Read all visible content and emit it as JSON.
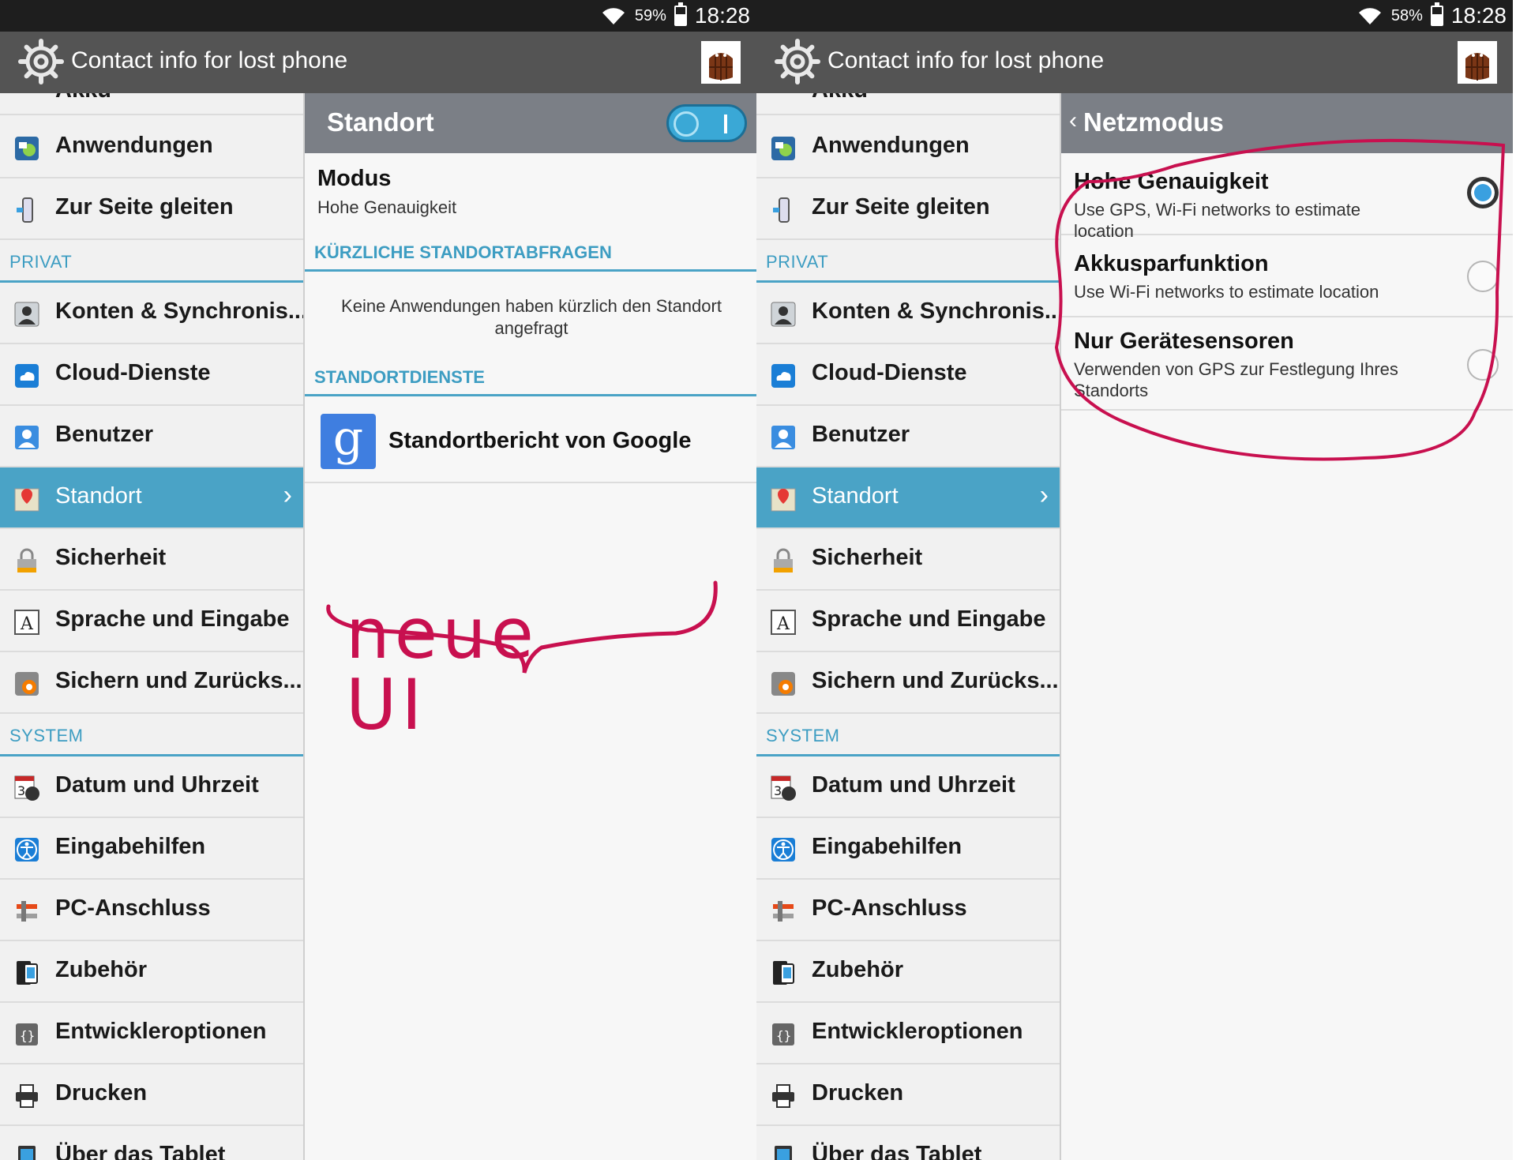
{
  "left": {
    "status": {
      "battery": "59%",
      "time": "18:28",
      "battery_level": 0.59
    },
    "app_title": "Contact info for lost phone",
    "list_items": [
      "Akku",
      "Anwendungen",
      "Zur Seite gleiten",
      "PRIVAT",
      "Konten & Synchronis...",
      "Cloud-Dienste",
      "Benutzer",
      "Standort",
      "Sicherheit",
      "Sprache und Eingabe",
      "Sichern und Zurücks...",
      "SYSTEM",
      "Datum und Uhrzeit",
      "Eingabehilfen",
      "PC-Anschluss",
      "Zubehör",
      "Entwickleroptionen",
      "Drucken",
      "Über das Tablet"
    ],
    "panel": {
      "title": "Standort",
      "switch_on": true,
      "modus_title": "Modus",
      "modus_value": "Hohe Genauigkeit",
      "section_recent": "KÜRZLICHE STANDORTABFRAGEN",
      "empty_message": "Keine Anwendungen haben kürzlich den Standort angefragt",
      "section_services": "STANDORTDIENSTE",
      "google_label": "Standortbericht von Google"
    },
    "annotation": "neue UI"
  },
  "right": {
    "status": {
      "battery": "58%",
      "time": "18:28",
      "battery_level": 0.58
    },
    "app_title": "Contact info for lost phone",
    "list_items": [
      "Akku",
      "Anwendungen",
      "Zur Seite gleiten",
      "PRIVAT",
      "Konten & Synchronis...",
      "Cloud-Dienste",
      "Benutzer",
      "Standort",
      "Sicherheit",
      "Sprache und Eingabe",
      "Sichern und Zurücks...",
      "SYSTEM",
      "Datum und Uhrzeit",
      "Eingabehilfen",
      "PC-Anschluss",
      "Zubehör",
      "Entwickleroptionen",
      "Drucken",
      "Über das Tablet"
    ],
    "panel": {
      "title": "Netzmodus",
      "options": [
        {
          "title": "Hohe Genauigkeit",
          "subtitle": "Use GPS, Wi-Fi networks to estimate location",
          "selected": true
        },
        {
          "title": "Akkusparfunktion",
          "subtitle": "Use Wi-Fi networks to estimate location",
          "selected": false
        },
        {
          "title": "Nur Gerätesensoren",
          "subtitle": "Verwenden von GPS zur Festlegung Ihres Standorts",
          "selected": false
        }
      ]
    }
  },
  "colors": {
    "accent": "#4aa3c6",
    "annotation_ink": "#c8104f"
  }
}
